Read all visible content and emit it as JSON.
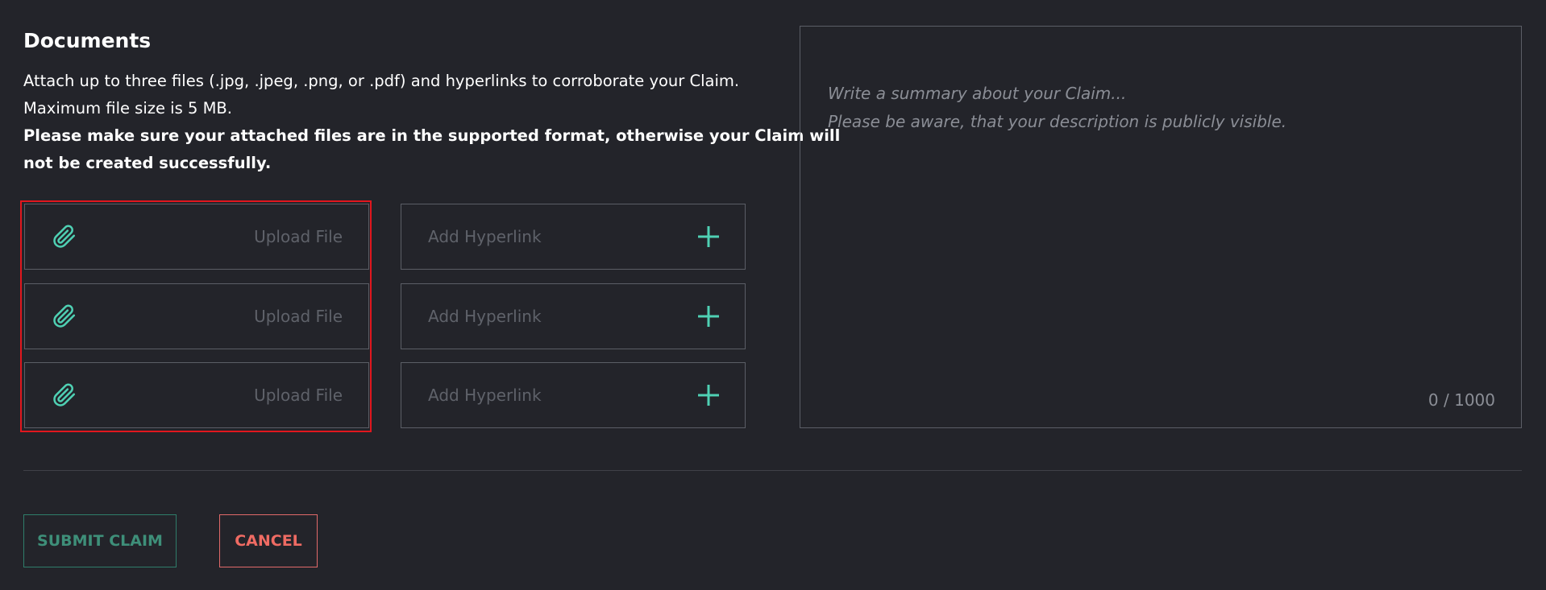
{
  "documents": {
    "title": "Documents",
    "description_line1": "Attach up to three files (.jpg, .jpeg, .png, or .pdf) and hyperlinks to corroborate your Claim.",
    "description_line2": "Maximum file size is 5 MB.",
    "warning_line1": "Please make sure your attached files are in the supported format, otherwise your Claim will",
    "warning_line2": "not be created successfully."
  },
  "uploads": [
    {
      "label": "Upload File",
      "icon": "paperclip-icon"
    },
    {
      "label": "Upload File",
      "icon": "paperclip-icon"
    },
    {
      "label": "Upload File",
      "icon": "paperclip-icon"
    }
  ],
  "hyperlinks": [
    {
      "placeholder": "Add Hyperlink",
      "icon": "plus-icon"
    },
    {
      "placeholder": "Add Hyperlink",
      "icon": "plus-icon"
    },
    {
      "placeholder": "Add Hyperlink",
      "icon": "plus-icon"
    }
  ],
  "summary": {
    "placeholder_line1": "Write a summary about your Claim...",
    "placeholder_line2": "Please be aware, that your description is publicly visible.",
    "counter": "0 / 1000"
  },
  "actions": {
    "submit_label": "SUBMIT CLAIM",
    "cancel_label": "CANCEL"
  },
  "colors": {
    "background": "#23242a",
    "accent": "#4fd1b4",
    "submit": "#3e8f79",
    "cancel": "#ef6b63",
    "highlight_border": "#e1171e"
  }
}
